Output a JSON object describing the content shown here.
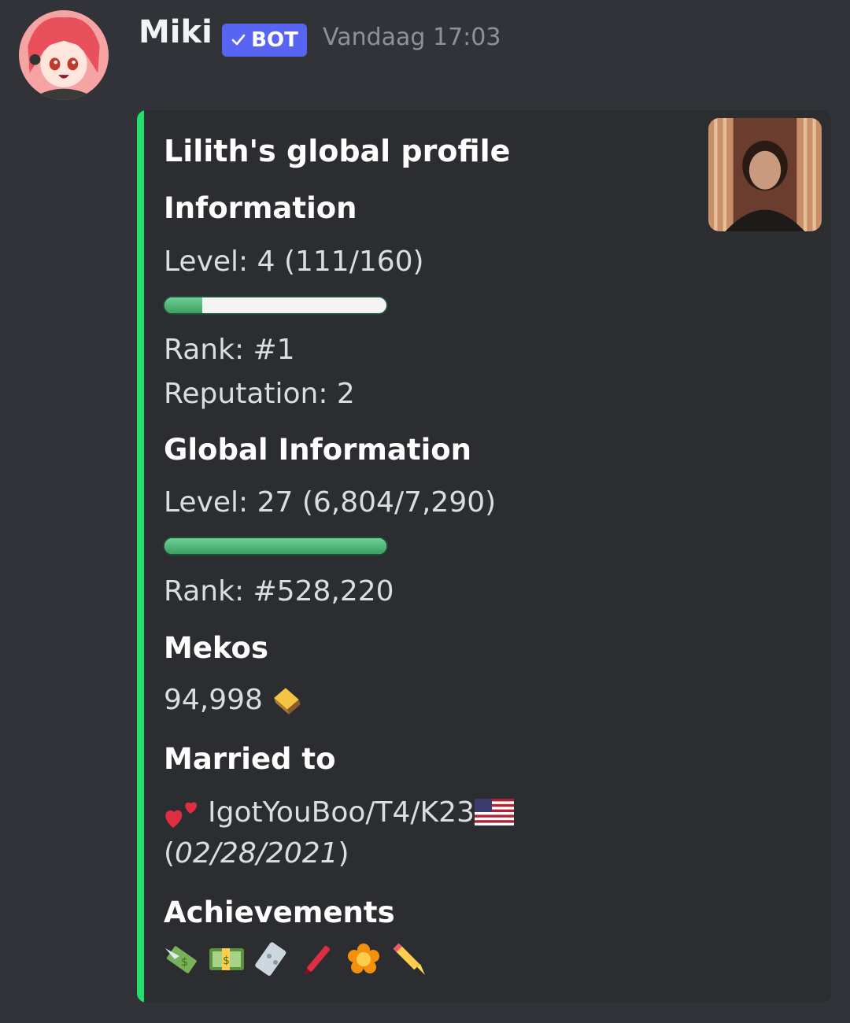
{
  "message": {
    "author": "Miki",
    "bot_label": "BOT",
    "timestamp": "Vandaag 17:03"
  },
  "embed": {
    "accent_color": "#22e06b",
    "title": "Lilith's global profile",
    "sections": {
      "information": {
        "heading": "Information",
        "level": "Level: 4 (111/160)",
        "progress": 0.17,
        "rank": "Rank: #1",
        "reputation": "Reputation: 2"
      },
      "global": {
        "heading": "Global Information",
        "level": "Level: 27 (6,804/7,290)",
        "progress": 1.0,
        "rank": "Rank: #528,220"
      },
      "mekos": {
        "heading": "Mekos",
        "value": "94,998"
      },
      "married": {
        "heading": "Married to",
        "partner": "IgotYouBoo/T4/K23",
        "date": "02/28/2021"
      },
      "achievements": {
        "heading": "Achievements",
        "icons": [
          "money-with-wings-icon",
          "banknote-icon",
          "ticket-icon",
          "crayon-icon",
          "flower-icon",
          "pencil-icon"
        ]
      }
    }
  }
}
